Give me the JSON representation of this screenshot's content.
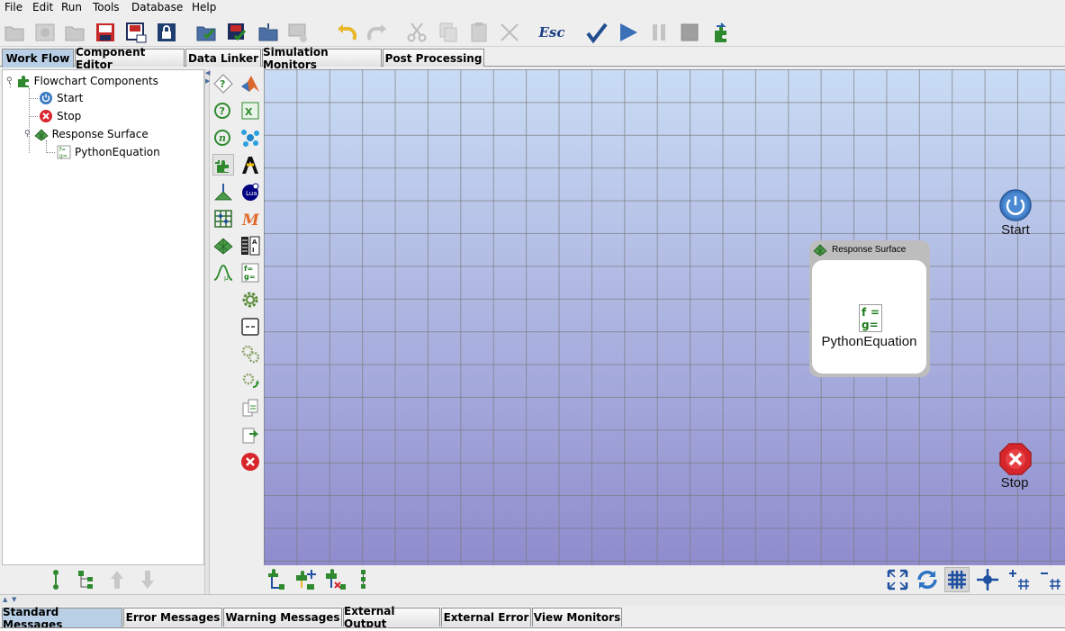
{
  "menu": [
    "File",
    "Edit",
    "Run",
    "Tools",
    "Database",
    "Help"
  ],
  "toolbar": {
    "esc_label": "Esc",
    "buttons": [
      "new-folder",
      "database",
      "open-folder",
      "save",
      "save-as",
      "lock",
      "folder-check",
      "save-check",
      "folder-up",
      "monitor",
      "undo",
      "redo",
      "cut",
      "copy",
      "paste",
      "delete",
      "escape",
      "validate",
      "run",
      "pause",
      "stop",
      "export-component"
    ]
  },
  "main_tabs": [
    "Work Flow",
    "Component Editor",
    "Data Linker",
    "Simulation Monitors",
    "Post Processing"
  ],
  "active_main_tab": "Work Flow",
  "tree": {
    "root": "Flowchart Components",
    "start": "Start",
    "stop": "Stop",
    "response_surface": "Response Surface",
    "python_equation": "PythonEquation"
  },
  "canvas": {
    "start_label": "Start",
    "stop_label": "Stop",
    "response_surface_title": "Response Surface",
    "python_equation_label": "PythonEquation"
  },
  "bottom_tabs": [
    "Standard Messages",
    "Error Messages",
    "Warning Messages",
    "External Output",
    "External Error",
    "View Monitors"
  ],
  "active_bottom_tab": "Standard Messages",
  "colors": {
    "tab_active": "#b8cfe5",
    "canvas_top": "#c9dcf4",
    "canvas_bottom": "#8f8ccd",
    "start_blue": "#3b79c2",
    "stop_red": "#d7262b",
    "component_green": "#2f8a2f"
  }
}
